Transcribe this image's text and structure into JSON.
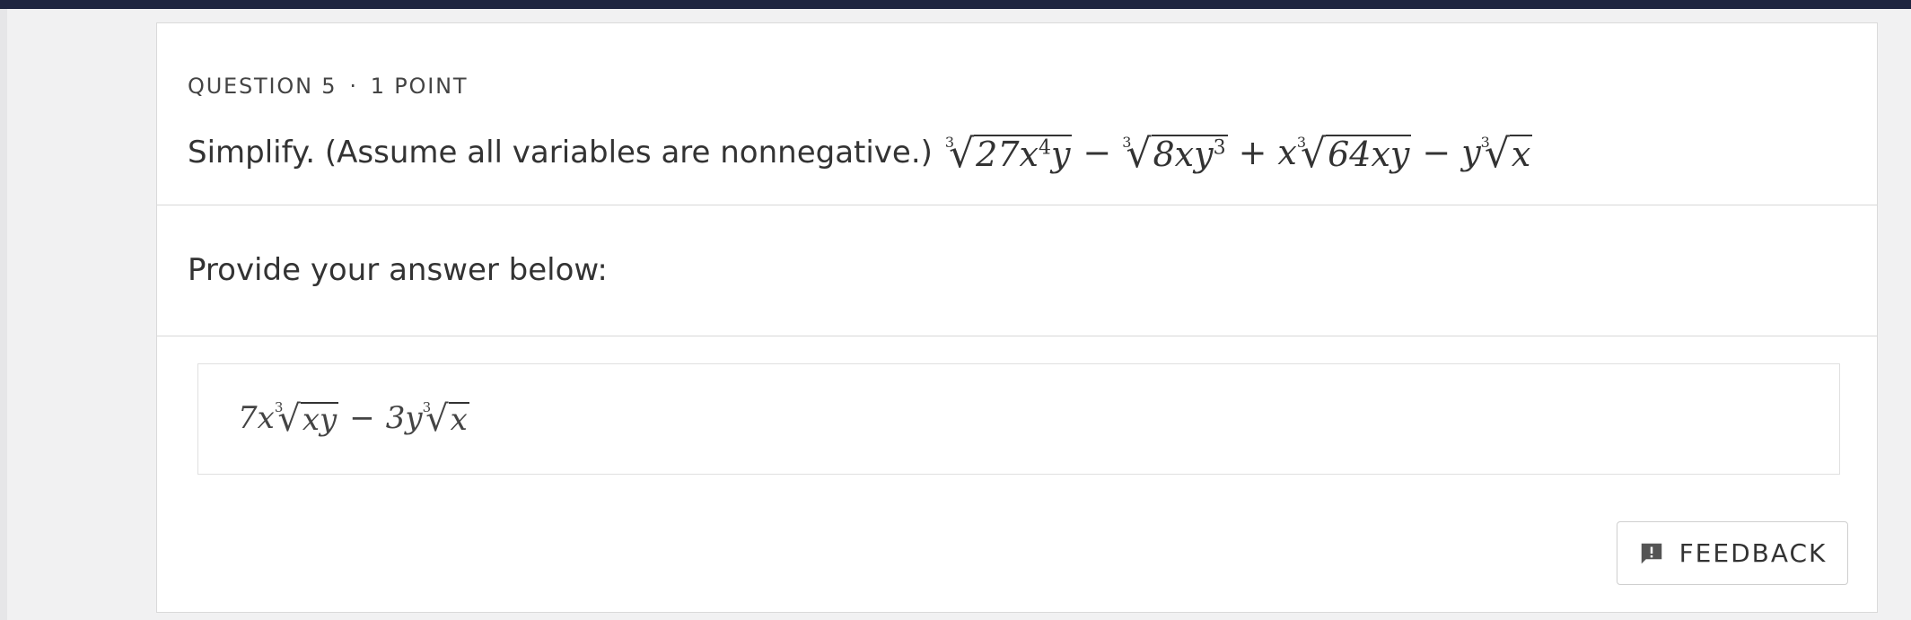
{
  "question": {
    "number_label": "QUESTION 5",
    "separator": "·",
    "points_label": "1 POINT",
    "prompt": "Simplify. (Assume all variables are nonnegative.)",
    "expression": {
      "term1_index": "3",
      "term1_arg": "27x",
      "term1_exp": "4",
      "term1_tail": "y",
      "op1": "−",
      "term2_index": "3",
      "term2_arg": "8xy",
      "term2_exp": "3",
      "op2": "+",
      "term3_coef": "x",
      "term3_index": "3",
      "term3_arg": "64xy",
      "op3": "−",
      "term4_coef": "y",
      "term4_index": "3",
      "term4_arg": "x"
    }
  },
  "answer_section": {
    "prompt": "Provide your answer below:",
    "answer": {
      "coef1": "7x",
      "index1": "3",
      "arg1": "xy",
      "op": "−",
      "coef2": "3y",
      "index2": "3",
      "arg2": "x"
    }
  },
  "feedback_button": {
    "icon": "feedback-icon",
    "label": "FEEDBACK"
  },
  "colors": {
    "topbar": "#1f2540",
    "text": "#333333",
    "border": "#d8d8d8"
  }
}
